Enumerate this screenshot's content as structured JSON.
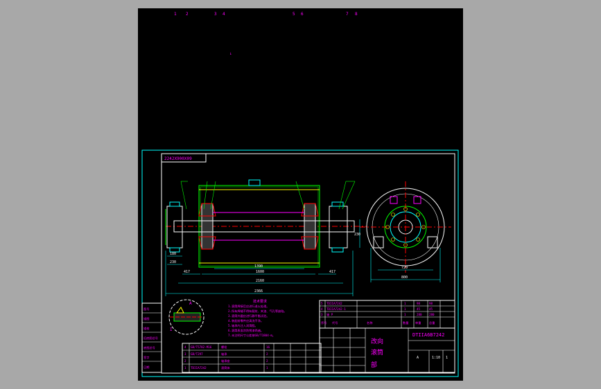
{
  "top_labels": [
    "1",
    "2",
    "3",
    "4",
    "5",
    "6",
    "7",
    "8"
  ],
  "top_marker": "↓",
  "drawing": {
    "part_number_box": "2242X900X09",
    "dimensions": {
      "shaft_length": "2366",
      "span_2": "2160",
      "span_1": "1600",
      "drum_width": "1390",
      "left_end": "417",
      "right_end": "417",
      "left_bearing": "180",
      "left_bearing_b": "230",
      "side_width": "720",
      "side_base": "800",
      "side_height": "230"
    },
    "tech_notes": {
      "title": "技术要求",
      "lines": [
        "1.滚筒焊接后应进行退火处理。",
        "2.所有焊缝不得有裂纹、夹渣、气孔等缺陷。",
        "3.滚筒外圆应进行静平衡试验。",
        "4.装配前零件应清洗干净。",
        "5.轴承内注入润滑脂。",
        "6.滚筒表面涂防锈漆两遍。",
        "7.未注明尺寸公差按GB/T1804-m。"
      ]
    },
    "title_block": {
      "drawing_no": "DTIIA6B7242",
      "name_1": "改向",
      "name_2": "滚筒",
      "dept": "部",
      "scale": "1:10",
      "qty": "1",
      "version": "A"
    },
    "upper_table": [
      [
        "5",
        "TDIIA7242",
        "1",
        "1",
        "98",
        "98"
      ],
      [
        "4",
        "TDIIA7242-1",
        "1",
        "1",
        "45",
        "45"
      ],
      [
        "3",
        "轴 P",
        "1",
        "1",
        "280",
        "280"
      ]
    ],
    "upper_header": [
      "序号",
      "代号",
      "名称",
      "数量",
      "单重",
      "总重"
    ],
    "parts_list": [
      [
        "4",
        "GB/T5782-M16",
        "螺栓",
        "16",
        "",
        ""
      ],
      [
        "3",
        "GB/T297",
        "轴承",
        "2",
        "",
        ""
      ],
      [
        "2",
        "",
        "轴承座",
        "2",
        "",
        ""
      ],
      [
        "1",
        "TDIIA7242",
        "滚筒体",
        "1",
        "",
        ""
      ]
    ],
    "left_strip": [
      "图号",
      "描图",
      "描校",
      "旧底图总号",
      "底图总号",
      "签字",
      "日期"
    ],
    "detail_mark": "A",
    "section_mark": "I"
  }
}
